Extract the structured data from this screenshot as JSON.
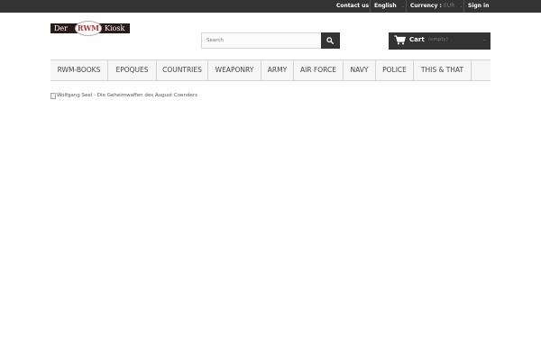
{
  "topbar": {
    "contact": "Contact us",
    "language": "English",
    "currency_label": "Currency :",
    "currency_value": "EUR",
    "signin": "Sign in"
  },
  "logo": {
    "left_word": "Der",
    "mark": "RWM",
    "right_word": "Kiosk"
  },
  "search": {
    "placeholder": "Search"
  },
  "cart": {
    "label": "Cart",
    "status": "(empty)"
  },
  "menu": {
    "items": [
      "RWM-BOOKS",
      "EPOQUES",
      "COUNTRIES",
      "WEAPONRY",
      "ARMY",
      "AIR FORCE",
      "NAVY",
      "POLICE",
      "THIS & THAT"
    ]
  },
  "product_image": {
    "alt": "Wolfgang Seel - Die Geheimwaffen des August Coenders"
  },
  "colors": {
    "topbar_bg": "#333333",
    "menu_bg": "#f6f6f6",
    "logo_accent": "#9b3a3a"
  },
  "icons": [
    "search-icon",
    "cart-icon",
    "chevron-down-icon",
    "broken-image-icon"
  ]
}
